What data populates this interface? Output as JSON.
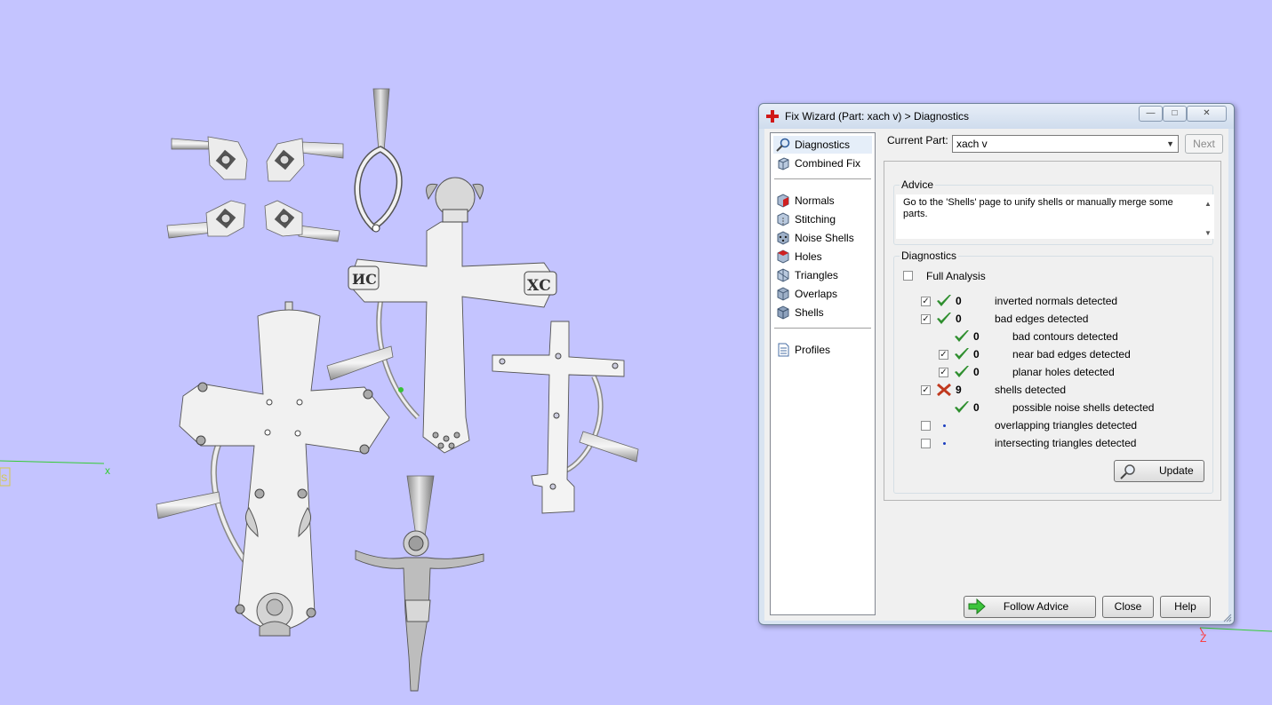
{
  "viewport": {
    "axis_x_label": "x",
    "axis_z_label": "Z",
    "corner_label": "S",
    "background_color": "#c4c4ff"
  },
  "dialog": {
    "title": "Fix Wizard (Part: xach v) > Diagnostics",
    "title_icon": "red-cross-icon",
    "current_part_label": "Current Part:",
    "current_part_value": "xach v",
    "next_label": "Next",
    "nav": {
      "items": [
        {
          "label": "Diagnostics",
          "icon": "magnifier-icon",
          "selected": true
        },
        {
          "label": "Combined Fix",
          "icon": "cube-icon"
        },
        {
          "label": "Normals",
          "icon": "cube-red-face-icon"
        },
        {
          "label": "Stitching",
          "icon": "cube-stitch-icon"
        },
        {
          "label": "Noise Shells",
          "icon": "dots-cube-icon"
        },
        {
          "label": "Holes",
          "icon": "cube-hole-icon"
        },
        {
          "label": "Triangles",
          "icon": "triangle-cube-icon"
        },
        {
          "label": "Overlaps",
          "icon": "overlap-cube-icon"
        },
        {
          "label": "Shells",
          "icon": "shells-cube-icon"
        },
        {
          "label": "Profiles",
          "icon": "document-icon"
        }
      ]
    },
    "advice": {
      "title": "Advice",
      "text": "Go to the 'Shells' page to unify shells or manually merge some parts."
    },
    "diagnostics": {
      "title": "Diagnostics",
      "full_analysis_label": "Full Analysis",
      "rows": [
        {
          "checkbox": true,
          "status": "ok",
          "count": "0",
          "label": "inverted normals detected"
        },
        {
          "checkbox": true,
          "status": "ok",
          "count": "0",
          "label": "bad edges detected"
        },
        {
          "checkbox": null,
          "status": "ok",
          "count": "0",
          "label": "bad contours detected"
        },
        {
          "checkbox": true,
          "status": "ok",
          "count": "0",
          "label": "near bad edges detected"
        },
        {
          "checkbox": true,
          "status": "ok",
          "count": "0",
          "label": "planar holes detected"
        },
        {
          "checkbox": true,
          "status": "error",
          "count": "9",
          "label": "shells detected"
        },
        {
          "checkbox": null,
          "status": "ok",
          "count": "0",
          "label": "possible noise shells detected"
        },
        {
          "checkbox": false,
          "status": "unknown",
          "count": "",
          "label": "overlapping triangles detected"
        },
        {
          "checkbox": false,
          "status": "unknown",
          "count": "",
          "label": "intersecting triangles detected"
        }
      ],
      "update_label": "Update"
    },
    "buttons": {
      "follow_advice": "Follow Advice",
      "close": "Close",
      "help": "Help"
    }
  }
}
